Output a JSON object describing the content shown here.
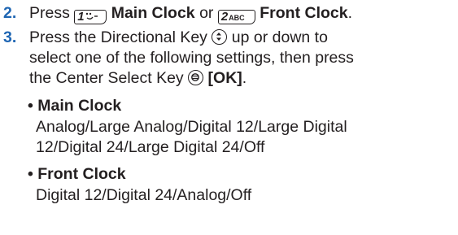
{
  "step2": {
    "number": "2.",
    "press": "Press",
    "key1_digit": "1",
    "key1_label": "Main Clock",
    "or": "or",
    "key2_digit": "2",
    "key2_glyph": "ABC",
    "key2_label": "Front Clock",
    "period": "."
  },
  "step3": {
    "number": "3.",
    "line1_a": "Press the Directional Key",
    "line1_b": "up or down to",
    "line2": "select one of the following settings, then press",
    "line3_a": "the Center Select Key",
    "line3_ok": "[OK]",
    "line3_period": "."
  },
  "main_clock": {
    "bullet": "•",
    "title": "Main Clock",
    "options_line1": "Analog/Large Analog/Digital 12/Large Digital",
    "options_line2": "12/Digital 24/Large Digital 24/Off"
  },
  "front_clock": {
    "bullet": "•",
    "title": "Front Clock",
    "options_line1": "Digital 12/Digital 24/Analog/Off"
  },
  "icons": {
    "key1": "key-1-icon",
    "key2": "key-2-abc-icon",
    "directional": "directional-key-icon",
    "center_select": "center-select-key-icon"
  }
}
